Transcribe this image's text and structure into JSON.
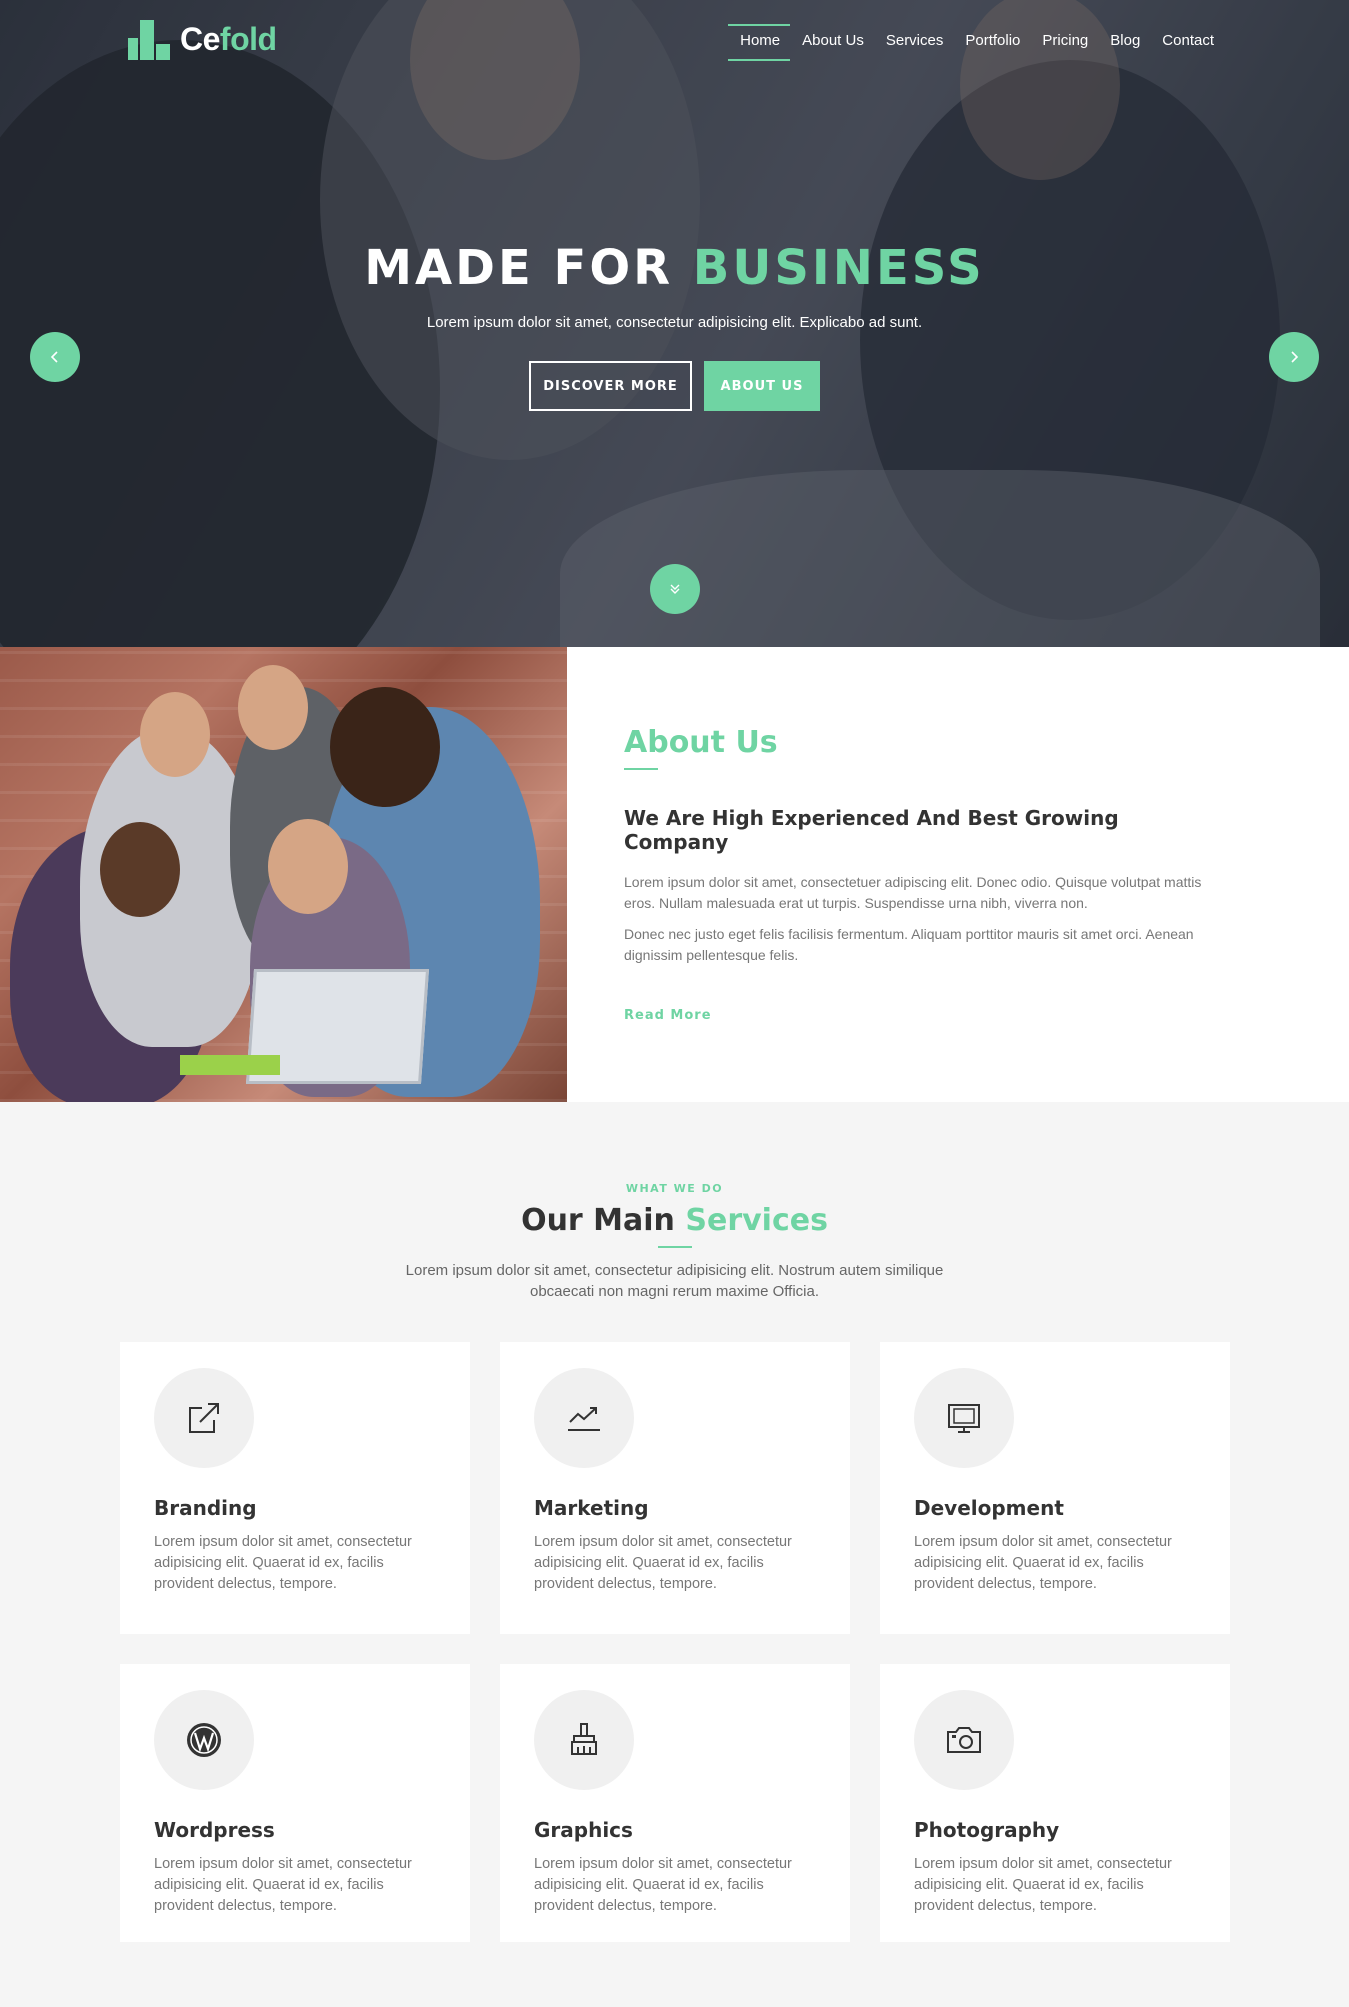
{
  "brand": {
    "name_a": "Ce",
    "name_b": "fold",
    "accent_color": "#6fd4a3"
  },
  "nav": [
    {
      "label": "Home",
      "active": true
    },
    {
      "label": "About Us"
    },
    {
      "label": "Services"
    },
    {
      "label": "Portfolio"
    },
    {
      "label": "Pricing"
    },
    {
      "label": "Blog"
    },
    {
      "label": "Contact"
    }
  ],
  "hero": {
    "title_a": "MADE FOR ",
    "title_b": "BUSINESS",
    "subtitle": "Lorem ipsum dolor sit amet, consectetur adipisicing elit. Explicabo ad sunt.",
    "btn_discover": "DISCOVER MORE",
    "btn_about": "ABOUT US",
    "prev_icon": "chevron-left-icon",
    "next_icon": "chevron-right-icon",
    "scroll_icon": "double-chevron-down-icon"
  },
  "about": {
    "title": "About Us",
    "subtitle": "We Are High Experienced And Best Growing Company",
    "p1": "Lorem ipsum dolor sit amet, consectetuer adipiscing elit. Donec odio. Quisque volutpat mattis eros. Nullam malesuada erat ut turpis. Suspendisse urna nibh, viverra non.",
    "p2": "Donec nec justo eget felis facilisis fermentum. Aliquam porttitor mauris sit amet orci. Aenean dignissim pellentesque felis.",
    "read_more": "Read More"
  },
  "services": {
    "eyebrow": "WHAT WE DO",
    "title_a": "Our Main ",
    "title_b": "Services",
    "desc": "Lorem ipsum dolor sit amet, consectetur adipisicing elit. Nostrum autem similique obcaecati non magni rerum maxime Officia.",
    "items": [
      {
        "title": "Branding",
        "icon": "external-link-icon",
        "text": "Lorem ipsum dolor sit amet, consectetur adipisicing elit. Quaerat id ex, facilis provident delectus, tempore."
      },
      {
        "title": "Marketing",
        "icon": "trending-up-icon",
        "text": "Lorem ipsum dolor sit amet, consectetur adipisicing elit. Quaerat id ex, facilis provident delectus, tempore."
      },
      {
        "title": "Development",
        "icon": "monitor-icon",
        "text": "Lorem ipsum dolor sit amet, consectetur adipisicing elit. Quaerat id ex, facilis provident delectus, tempore."
      },
      {
        "title": "Wordpress",
        "icon": "wordpress-icon",
        "text": "Lorem ipsum dolor sit amet, consectetur adipisicing elit. Quaerat id ex, facilis provident delectus, tempore."
      },
      {
        "title": "Graphics",
        "icon": "brush-icon",
        "text": "Lorem ipsum dolor sit amet, consectetur adipisicing elit. Quaerat id ex, facilis provident delectus, tempore."
      },
      {
        "title": "Photography",
        "icon": "camera-icon",
        "text": "Lorem ipsum dolor sit amet, consectetur adipisicing elit. Quaerat id ex, facilis provident delectus, tempore."
      }
    ]
  }
}
